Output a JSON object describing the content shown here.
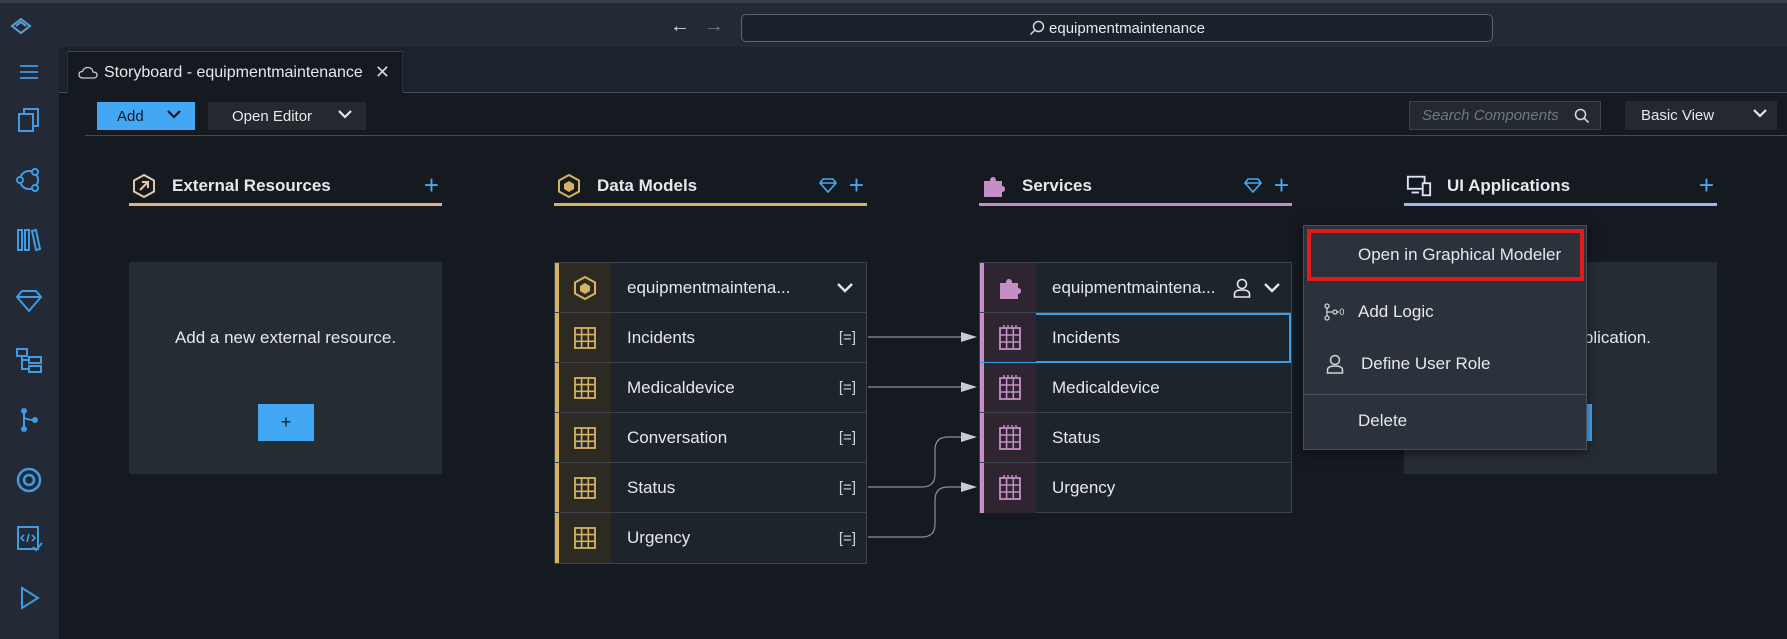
{
  "titlebar": {
    "search_text": "equipmentmaintenance"
  },
  "tab": {
    "label": "Storyboard - equipmentmaintenance"
  },
  "toolbar": {
    "add_label": "Add",
    "open_editor_label": "Open Editor",
    "search_placeholder": "Search Components",
    "view_label": "Basic View"
  },
  "columns": {
    "external": {
      "title": "External Resources",
      "empty_msg": "Add a new external resource.",
      "add_btn": "+"
    },
    "data_models": {
      "title": "Data Models"
    },
    "services": {
      "title": "Services"
    },
    "ui_apps": {
      "title": "UI Applications",
      "empty_msg_fragment": "plication."
    }
  },
  "data_model": {
    "name": "equipmentmaintena...",
    "entities": [
      "Incidents",
      "Medicaldevice",
      "Conversation",
      "Status",
      "Urgency"
    ],
    "entity_control": "[=]"
  },
  "service": {
    "name": "equipmentmaintena...",
    "entities": [
      "Incidents",
      "Medicaldevice",
      "Status",
      "Urgency"
    ]
  },
  "context_menu": {
    "items": [
      "Open in Graphical Modeler",
      "Add Logic",
      "Define User Role",
      "Delete"
    ],
    "highlighted": "Open in Graphical Modeler"
  },
  "colors": {
    "accent": "#43a8f3",
    "external_line": "#d9b38c",
    "data_line": "#d6b265",
    "services_line": "#c58fc6",
    "ui_line": "#9fb7ef",
    "highlight": "#e01b1b"
  }
}
